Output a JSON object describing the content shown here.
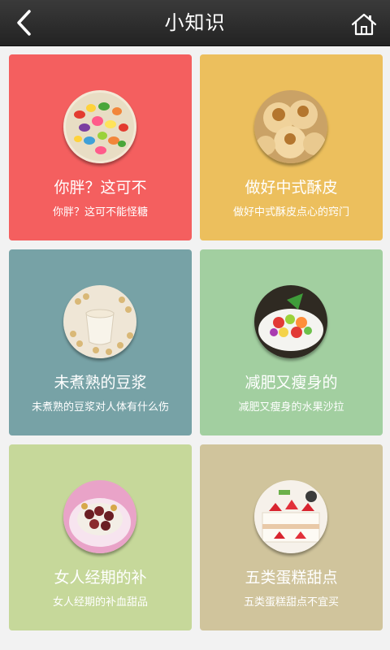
{
  "header": {
    "title": "小知识",
    "back_icon": "back-arrow-icon",
    "home_icon": "home-icon",
    "background": "#2b2b2b"
  },
  "cards": [
    {
      "title": "你胖？这可不",
      "subtitle": "你胖？这可不能怪糖",
      "color": "#f45f5f",
      "image": "jelly-beans-image"
    },
    {
      "title": "做好中式酥皮",
      "subtitle": "做好中式酥皮点心的窍门",
      "color": "#ecbf5d",
      "image": "pastry-image"
    },
    {
      "title": "未煮熟的豆浆",
      "subtitle": "未煮熟的豆浆对人体有什么伤",
      "color": "#77a2a6",
      "image": "soy-milk-image"
    },
    {
      "title": "减肥又瘦身的",
      "subtitle": "减肥又瘦身的水果沙拉",
      "color": "#a2cfa0",
      "image": "fruit-salad-image"
    },
    {
      "title": "女人经期的补",
      "subtitle": "女人经期的补血甜品",
      "color": "#c6d89a",
      "image": "red-bean-dessert-image"
    },
    {
      "title": "五类蛋糕甜点",
      "subtitle": "五类蛋糕甜点不宜买",
      "color": "#d0c49c",
      "image": "strawberry-cake-image"
    }
  ]
}
